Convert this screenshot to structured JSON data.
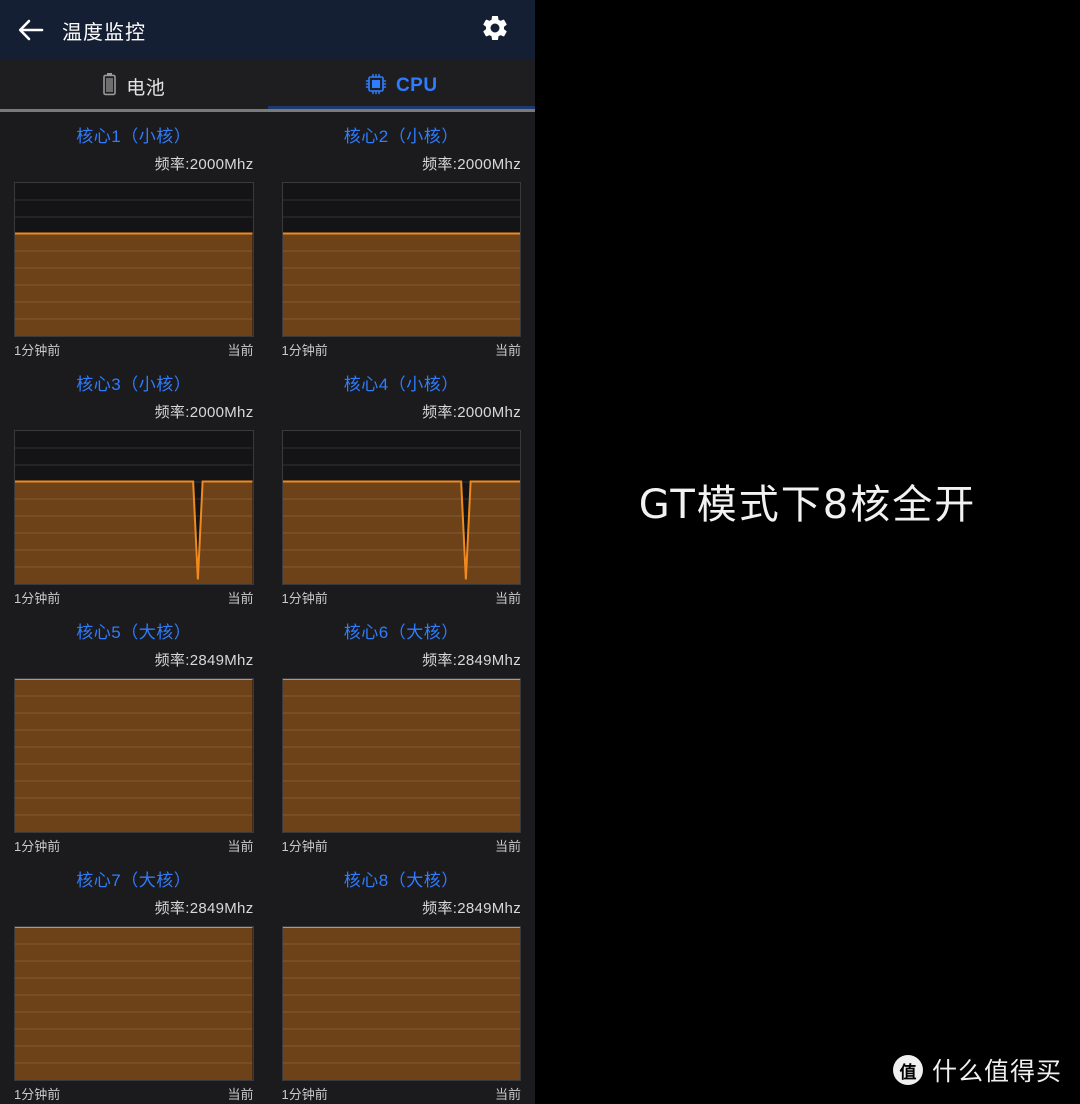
{
  "header": {
    "title": "温度监控",
    "back_icon": "back-arrow-icon",
    "settings_icon": "gear-icon"
  },
  "tabs": [
    {
      "id": "battery",
      "label": "电池",
      "icon": "battery-icon",
      "active": false
    },
    {
      "id": "cpu",
      "label": "CPU",
      "icon": "cpu-chip-icon",
      "active": true
    }
  ],
  "axis": {
    "left_label": "1分钟前",
    "right_label": "当前"
  },
  "colors": {
    "accent_blue": "#2e7dff",
    "graph_line": "#f08a1e",
    "graph_fill": "#6d4219",
    "graph_bg": "#141416",
    "appbar_bg": "#141f33",
    "page_bg": "#1b1b1d"
  },
  "caption": {
    "text": "GT模式下8核全开"
  },
  "watermark": {
    "logo_char": "值",
    "text": "什么值得买"
  },
  "chart_data": [
    {
      "type": "area",
      "title": "核心1（小核）",
      "freq_label": "频率:2000Mhz",
      "freq_mhz": 2000,
      "core_type": "小核",
      "xlabel": "",
      "ylabel": "",
      "x": [
        0,
        10,
        20,
        30,
        40,
        50,
        60,
        70,
        77,
        80,
        90,
        100
      ],
      "values": [
        67,
        67,
        67,
        67,
        67,
        67,
        67,
        67,
        67,
        67,
        67,
        67
      ],
      "ylim": [
        0,
        100
      ],
      "grid": true
    },
    {
      "type": "area",
      "title": "核心2（小核）",
      "freq_label": "频率:2000Mhz",
      "freq_mhz": 2000,
      "core_type": "小核",
      "xlabel": "",
      "ylabel": "",
      "x": [
        0,
        10,
        20,
        30,
        40,
        50,
        60,
        70,
        77,
        80,
        90,
        100
      ],
      "values": [
        67,
        67,
        67,
        67,
        67,
        67,
        67,
        67,
        67,
        67,
        67,
        67
      ],
      "ylim": [
        0,
        100
      ],
      "grid": true
    },
    {
      "type": "area",
      "title": "核心3（小核）",
      "freq_label": "频率:2000Mhz",
      "freq_mhz": 2000,
      "core_type": "小核",
      "xlabel": "",
      "ylabel": "",
      "x": [
        0,
        10,
        20,
        30,
        40,
        50,
        60,
        70,
        75,
        77,
        79,
        82,
        90,
        100
      ],
      "values": [
        67,
        67,
        67,
        67,
        67,
        67,
        67,
        67,
        67,
        3,
        67,
        67,
        67,
        67
      ],
      "ylim": [
        0,
        100
      ],
      "grid": true
    },
    {
      "type": "area",
      "title": "核心4（小核）",
      "freq_label": "频率:2000Mhz",
      "freq_mhz": 2000,
      "core_type": "小核",
      "xlabel": "",
      "ylabel": "",
      "x": [
        0,
        10,
        20,
        30,
        40,
        50,
        60,
        70,
        75,
        77,
        79,
        82,
        90,
        100
      ],
      "values": [
        67,
        67,
        67,
        67,
        67,
        67,
        67,
        67,
        67,
        3,
        67,
        67,
        67,
        67
      ],
      "ylim": [
        0,
        100
      ],
      "grid": true
    },
    {
      "type": "area",
      "title": "核心5（大核）",
      "freq_label": "频率:2849Mhz",
      "freq_mhz": 2849,
      "core_type": "大核",
      "xlabel": "",
      "ylabel": "",
      "x": [
        0,
        10,
        20,
        30,
        40,
        50,
        60,
        70,
        80,
        90,
        100
      ],
      "values": [
        100,
        100,
        100,
        100,
        100,
        100,
        100,
        100,
        100,
        100,
        100
      ],
      "ylim": [
        0,
        100
      ],
      "grid": true
    },
    {
      "type": "area",
      "title": "核心6（大核）",
      "freq_label": "频率:2849Mhz",
      "freq_mhz": 2849,
      "core_type": "大核",
      "xlabel": "",
      "ylabel": "",
      "x": [
        0,
        10,
        20,
        30,
        40,
        50,
        60,
        70,
        80,
        90,
        100
      ],
      "values": [
        100,
        100,
        100,
        100,
        100,
        100,
        100,
        100,
        100,
        100,
        100
      ],
      "ylim": [
        0,
        100
      ],
      "grid": true
    },
    {
      "type": "area",
      "title": "核心7（大核）",
      "freq_label": "频率:2849Mhz",
      "freq_mhz": 2849,
      "core_type": "大核",
      "xlabel": "",
      "ylabel": "",
      "x": [
        0,
        10,
        20,
        30,
        40,
        50,
        60,
        70,
        80,
        90,
        100
      ],
      "values": [
        100,
        100,
        100,
        100,
        100,
        100,
        100,
        100,
        100,
        100,
        100
      ],
      "ylim": [
        0,
        100
      ],
      "grid": true
    },
    {
      "type": "area",
      "title": "核心8（大核）",
      "freq_label": "频率:2849Mhz",
      "freq_mhz": 2849,
      "core_type": "大核",
      "xlabel": "",
      "ylabel": "",
      "x": [
        0,
        10,
        20,
        30,
        40,
        50,
        60,
        70,
        80,
        90,
        100
      ],
      "values": [
        100,
        100,
        100,
        100,
        100,
        100,
        100,
        100,
        100,
        100,
        100
      ],
      "ylim": [
        0,
        100
      ],
      "grid": true
    }
  ]
}
